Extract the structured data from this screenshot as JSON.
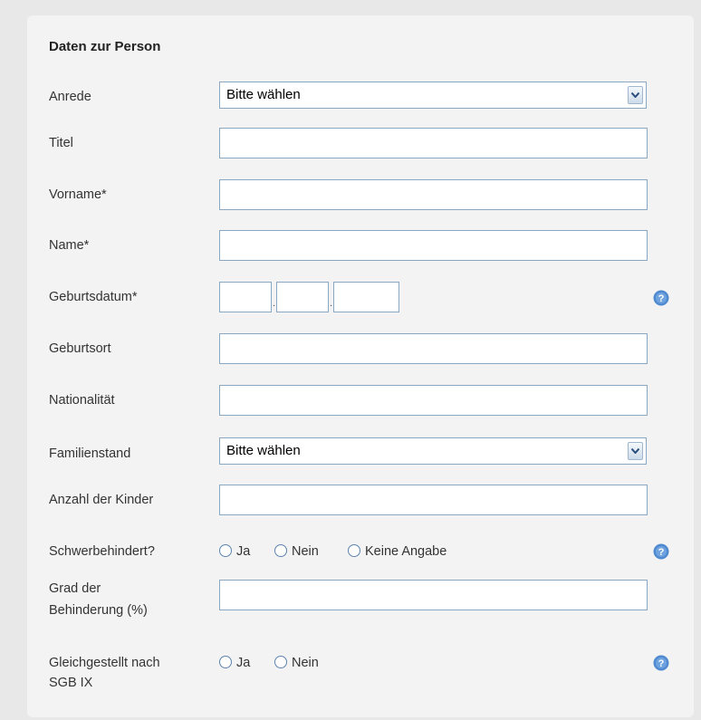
{
  "section": {
    "title": "Daten zur Person"
  },
  "fields": {
    "anrede": {
      "label": "Anrede",
      "selected": "Bitte wählen"
    },
    "titel": {
      "label": "Titel",
      "value": ""
    },
    "vorname": {
      "label": "Vorname*",
      "value": ""
    },
    "name": {
      "label": "Name*",
      "value": ""
    },
    "geburtsdatum": {
      "label": "Geburtsdatum*",
      "day": "",
      "month": "",
      "year": "",
      "separator": "."
    },
    "geburtsort": {
      "label": "Geburtsort",
      "value": ""
    },
    "nationalitaet": {
      "label": "Nationalität",
      "value": ""
    },
    "familienstand": {
      "label": "Familienstand",
      "selected": "Bitte wählen"
    },
    "kinder": {
      "label": "Anzahl der Kinder",
      "value": ""
    },
    "schwerbehindert": {
      "label": "Schwerbehindert?",
      "options": [
        "Ja",
        "Nein",
        "Keine Angabe"
      ]
    },
    "grad": {
      "label_line1": "Grad der",
      "label_line2": "Behinderung (%)",
      "value": ""
    },
    "gleichgestellt": {
      "label_line1": "Gleichgestellt nach",
      "label_line2": "SGB IX",
      "options": [
        "Ja",
        "Nein"
      ]
    }
  },
  "icons": {
    "help": "help-icon",
    "dropdown": "chevron-down-icon",
    "radio": "radio-icon"
  },
  "colors": {
    "input_border": "#8aa7c1",
    "help_icon": "#4f8ad0",
    "panel_bg": "#f3f3f3",
    "page_bg": "#e8e8e8"
  }
}
